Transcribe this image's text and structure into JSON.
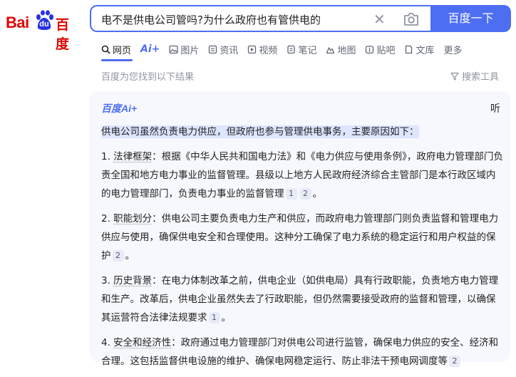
{
  "logo": {
    "bai": "Bai",
    "du": "du",
    "cn": "百度"
  },
  "search": {
    "query": "电不是供电公司管吗?为什么政府也有管供电的",
    "button_label": "百度一下",
    "clear_glyph": "✕"
  },
  "tabs": [
    {
      "label": "网页",
      "icon": "search-icon"
    },
    {
      "label": "Ai+",
      "icon": "ai-icon"
    },
    {
      "label": "图片",
      "icon": "image-icon"
    },
    {
      "label": "资讯",
      "icon": "news-icon"
    },
    {
      "label": "视频",
      "icon": "video-icon"
    },
    {
      "label": "笔记",
      "icon": "note-icon"
    },
    {
      "label": "地图",
      "icon": "map-icon"
    },
    {
      "label": "贴吧",
      "icon": "tieba-icon"
    },
    {
      "label": "文库",
      "icon": "doc-icon"
    },
    {
      "label": "更多",
      "icon": ""
    }
  ],
  "result_info": {
    "count_text": "百度为您找到以下结果",
    "tools_label": "搜索工具"
  },
  "ai_card": {
    "brand": "百度Ai+",
    "listen_label": "听",
    "intro": "供电公司虽然负责电力供应，但政府也参与管理供电事务，主要原因如下：",
    "points": [
      {
        "num": "1. ",
        "title": "法律框架",
        "text": "：根据《中华人民共和国电力法》和《电力供应与使用条例》，政府电力管理部门负责全国和地方电力事业的监督管理。县级以上地方人民政府经济综合主管部门是本行政区域内的电力管理部门，负责电力事业的监督管理",
        "refs": [
          "1",
          "2"
        ],
        "end": "。"
      },
      {
        "num": "2. ",
        "title": "职能划分",
        "text": "：供电公司主要负责电力生产和供应，而政府电力管理部门则负责监督和管理电力供应与使用，确保供电安全和合理使用。这种分工确保了电力系统的稳定运行和用户权益的保护",
        "refs": [
          "2"
        ],
        "end": "。"
      },
      {
        "num": "3. ",
        "title": "历史背景",
        "text": "：在电力体制改革之前，供电企业（如供电局）具有行政职能，负责地方电力管理和生产。改革后，供电企业虽然失去了行政职能，但仍然需要接受政府的监督和管理，以确保其运营符合法律法规要求",
        "refs": [
          "1"
        ],
        "end": "。"
      },
      {
        "num": "4. ",
        "title": "安全和经济性",
        "text": "：政府通过电力管理部门对供电公司进行监管，确保电力供应的安全、经济和合理。这包括监督供电设施的维护、确保电网稳定运行、防止非法干预电网调度等",
        "refs": [
          "2"
        ],
        "end": ""
      }
    ]
  },
  "colors": {
    "brand_red": "#e10601",
    "accent_blue": "#4e6ef2",
    "card_bg": "#f7f8fd"
  }
}
